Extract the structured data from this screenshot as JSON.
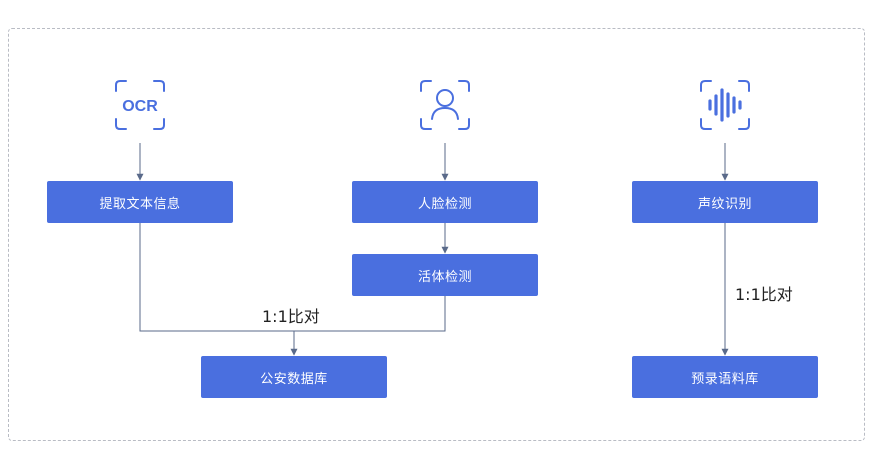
{
  "icons": {
    "ocr": {
      "name": "ocr-icon",
      "text": "OCR"
    },
    "face": {
      "name": "face-scan-icon"
    },
    "voice": {
      "name": "voiceprint-icon"
    }
  },
  "boxes": {
    "extract_text": "提取文本信息",
    "face_detect": "人脸检测",
    "liveness": "活体检测",
    "voiceprint": "声纹识别",
    "police_db": "公安数据库",
    "corpus_db": "预录语料库"
  },
  "labels": {
    "compare_left": "1:1比对",
    "compare_right": "1:1比对"
  },
  "colors": {
    "accent": "#4a6fdf",
    "line": "#5a6a8a",
    "border": "#b9bcc4"
  }
}
